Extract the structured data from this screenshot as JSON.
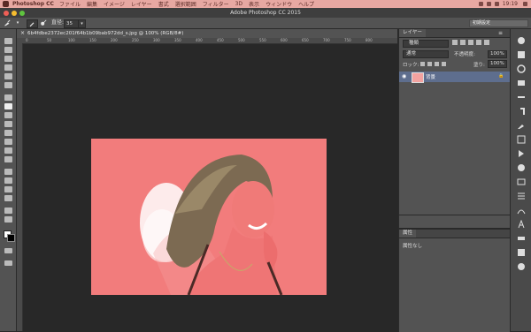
{
  "menubar": {
    "app_name": "Photoshop CC",
    "items": [
      "ファイル",
      "編集",
      "イメージ",
      "レイヤー",
      "書式",
      "選択範囲",
      "フィルター",
      "3D",
      "表示",
      "ウィンドウ",
      "ヘルプ"
    ],
    "clock": "19:19"
  },
  "window": {
    "title": "Adobe Photoshop CC 2015"
  },
  "options_bar": {
    "size_label": "直径:",
    "size_value": "35",
    "workspace": "初期設定"
  },
  "document": {
    "tab_title": "6b4fdbe2372ec201f64b1b09bab972dd_s.jpg @ 100% (RGB/8#)",
    "ruler_ticks": [
      "0",
      "50",
      "100",
      "150",
      "200",
      "250",
      "300",
      "350",
      "400",
      "450",
      "500",
      "550",
      "600",
      "650",
      "700",
      "750",
      "800"
    ]
  },
  "layers_panel": {
    "tab_label": "レイヤー",
    "kind_filter": "種類",
    "blend_mode": "通常",
    "opacity_label": "不透明度:",
    "opacity_value": "100%",
    "lock_label": "ロック:",
    "fill_label": "塗り:",
    "fill_value": "100%",
    "layer_name": "背景"
  },
  "properties_panel": {
    "tab_label": "属性",
    "content": "属性なし"
  },
  "colors": {
    "canvas_bg": "#f27c7c",
    "menubar_bg": "#e7a8a2",
    "panel_bg": "#535353",
    "selected_layer": "#5e6e8e"
  }
}
